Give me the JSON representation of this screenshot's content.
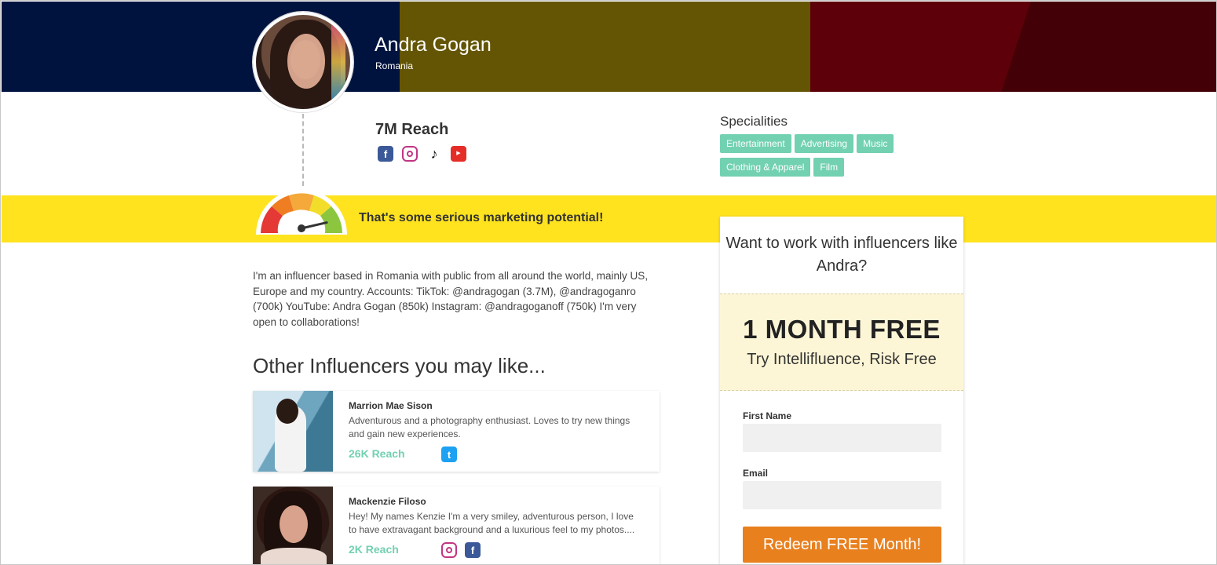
{
  "profile": {
    "name": "Andra Gogan",
    "country": "Romania",
    "reach": "7M Reach",
    "socials": [
      "facebook-icon",
      "instagram-icon",
      "tiktok-icon",
      "youtube-icon"
    ]
  },
  "specialities": {
    "title": "Specialities",
    "tags": [
      "Entertainment",
      "Advertising",
      "Music",
      "Clothing & Apparel",
      "Film"
    ]
  },
  "potential": {
    "text": "That's some serious marketing potential!",
    "gauge_level": 0.85
  },
  "bio": "I'm an influencer based in Romania with public from all around the world, mainly US, Europe and my country. Accounts: TikTok: @andragogan (3.7M), @andragoganro (700k) YouTube: Andra Gogan (850k) Instagram: @andragoganoff (750k) I'm very open to collaborations!",
  "others": {
    "title": "Other Influencers you may like...",
    "items": [
      {
        "name": "Marrion Mae Sison",
        "description": "Adventurous and a photography enthusiast. Loves to try new things and gain new experiences.",
        "reach": "26K Reach",
        "icons": [
          "twitter-icon"
        ]
      },
      {
        "name": "Mackenzie Filoso",
        "description": "Hey! My names Kenzie I'm a very smiley, adventurous person, I love to have extravagant background and a luxurious feel to my photos....",
        "reach": "2K Reach",
        "icons": [
          "instagram-icon",
          "facebook-icon"
        ]
      }
    ]
  },
  "signup": {
    "title": "Want to work with influencers like Andra?",
    "promo_big": "1 MONTH FREE",
    "promo_small": "Try Intellifluence, Risk Free",
    "first_name_label": "First Name",
    "first_name_value": "",
    "email_label": "Email",
    "email_value": "",
    "button": "Redeem FREE Month!"
  },
  "colors": {
    "banner": [
      "#00133f",
      "#645504",
      "#5e0009"
    ],
    "strip": "#ffe31f",
    "tag": "#72d1b0",
    "cta": "#e8801e"
  }
}
